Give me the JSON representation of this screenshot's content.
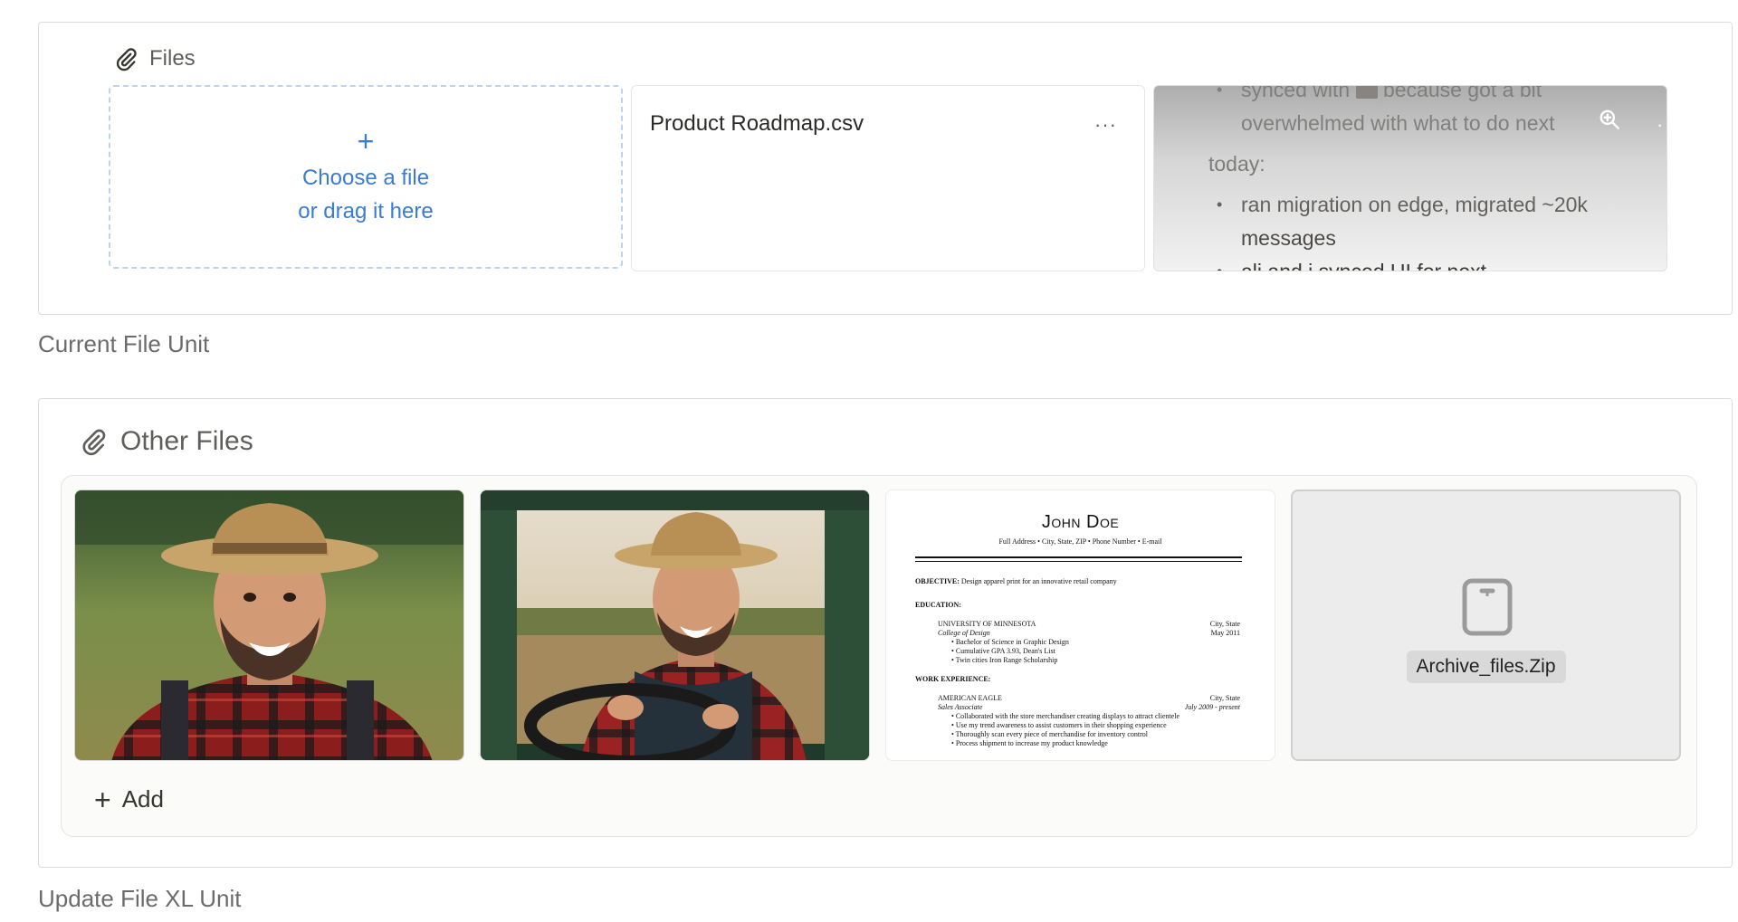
{
  "files_section": {
    "title": "Files",
    "upload": {
      "plus": "+",
      "line1": "Choose a file",
      "line2": "or drag it here"
    },
    "csv_file": {
      "name": "Product Roadmap.csv",
      "more": "···"
    },
    "note_preview": {
      "more": "···",
      "item1_a": "synced with",
      "item1_b": "because got a bit overwhelmed with what to do next",
      "para": "today:",
      "item2": "ran migration on edge, migrated ~20k messages",
      "item3": "ali and i synced UI for next..."
    },
    "caption": "Current File Unit"
  },
  "other_files_section": {
    "title": "Other Files",
    "add_label": "Add",
    "add_plus": "+",
    "resume": {
      "name": "John Doe",
      "contact": "Full Address • City, State, ZIP • Phone Number • E-mail",
      "objective_label": "OBJECTIVE:",
      "objective": "Design apparel print for an innovative retail company",
      "education_label": "EDUCATION:",
      "school": "UNIVERSITY OF MINNESOTA",
      "school_loc": "City, State",
      "college": "College of Design",
      "grad_date": "May 2011",
      "edu_1": "Bachelor of Science in Graphic Design",
      "edu_2": "Cumulative GPA 3.93, Dean's List",
      "edu_3": "Twin cities Iron Range Scholarship",
      "work_label": "WORK EXPERIENCE:",
      "employer": "AMERICAN EAGLE",
      "employer_loc": "City, State",
      "job_title": "Sales Associate",
      "job_dates": "July 2009 - present",
      "work_1": "Collaborated with the store merchandiser creating displays to attract clientele",
      "work_2": "Use my trend awareness to assist customers in their shopping experience",
      "work_3": "Thoroughly scan every piece of merchandise for inventory control",
      "work_4": "Process shipment to increase my product knowledge"
    },
    "archive": {
      "name": "Archive_files.Zip"
    },
    "caption": "Update File XL Unit"
  },
  "colors": {
    "accent": "#3a7bd5",
    "border": "#dcdcdc",
    "caption": "#6b6b6b"
  }
}
